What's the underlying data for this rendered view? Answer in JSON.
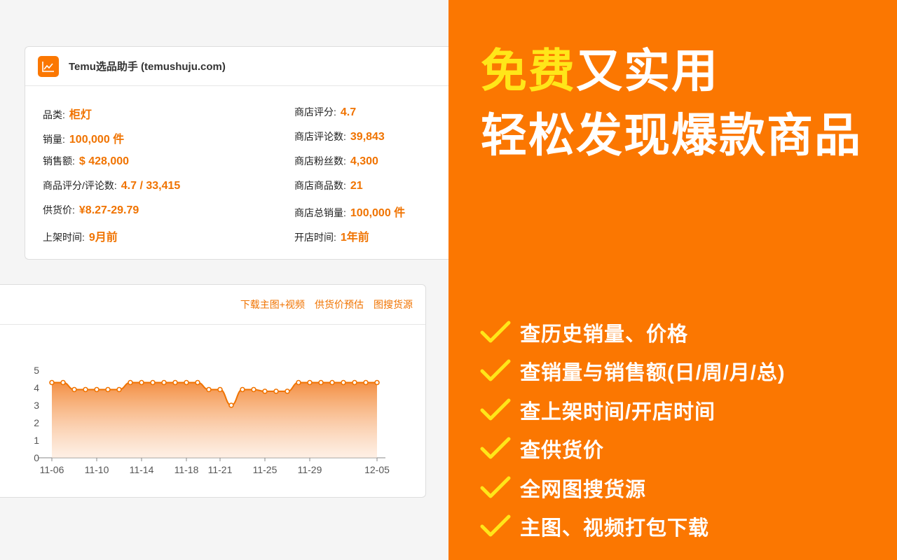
{
  "info_card": {
    "title": "Temu选品助手 (temushuju.com)",
    "logo_icon": "trend-chart-icon",
    "left_items": [
      {
        "label": "品类:",
        "value": "柜灯"
      },
      {
        "label": "销量:",
        "value": "100,000 件"
      },
      {
        "label": "销售额:",
        "value": "$ 428,000"
      },
      {
        "label": "商品评分/评论数:",
        "value": "4.7 / 33,415"
      },
      {
        "label": "供货价:",
        "value": "¥8.27-29.79"
      },
      {
        "label": "上架时间:",
        "value": "9月前"
      }
    ],
    "right_items": [
      {
        "label": "商店评分:",
        "value": "4.7"
      },
      {
        "label": "商店评论数:",
        "value": "39,843"
      },
      {
        "label": "商店粉丝数:",
        "value": "4,300"
      },
      {
        "label": "商店商品数:",
        "value": "21"
      },
      {
        "label": "商店总销量:",
        "value": "100,000 件"
      },
      {
        "label": "开店时间:",
        "value": "1年前"
      }
    ]
  },
  "chart_card": {
    "links": [
      "下载主图+视频",
      "供货价预估",
      "图搜货源"
    ]
  },
  "chart_data": {
    "type": "area",
    "x": [
      "11-06",
      "11-07",
      "11-08",
      "11-09",
      "11-10",
      "11-11",
      "11-12",
      "11-13",
      "11-14",
      "11-15",
      "11-16",
      "11-17",
      "11-18",
      "11-19",
      "11-20",
      "11-21",
      "11-22",
      "11-23",
      "11-24",
      "11-25",
      "11-26",
      "11-27",
      "11-28",
      "11-29",
      "11-30",
      "12-01",
      "12-02",
      "12-03",
      "12-04",
      "12-05"
    ],
    "series": [
      {
        "values": [
          4.3,
          4.3,
          3.9,
          3.9,
          3.9,
          3.9,
          3.9,
          4.3,
          4.3,
          4.3,
          4.3,
          4.3,
          4.3,
          4.3,
          3.9,
          3.9,
          3.0,
          3.9,
          3.9,
          3.8,
          3.8,
          3.8,
          4.3,
          4.3,
          4.3,
          4.3,
          4.3,
          4.3,
          4.3,
          4.3
        ]
      }
    ],
    "xticks": [
      "11-06",
      "11-10",
      "11-14",
      "11-18",
      "11-21",
      "11-25",
      "11-29",
      "12-05"
    ],
    "yticks": [
      "0",
      "1",
      "2",
      "3",
      "4",
      "5"
    ],
    "ylim": [
      0,
      5
    ],
    "color": "#f07300"
  },
  "promo": {
    "line1_highlight": "免费",
    "line1_rest": "又实用",
    "line2": "轻松发现爆款商品",
    "highlight_color": "#ffe619",
    "background_color": "#fb7701",
    "check_icon": "check-icon",
    "features": [
      "查历史销量、价格",
      "查销量与销售额(日/周/月/总)",
      "查上架时间/开店时间",
      "查供货价",
      "全网图搜货源",
      "主图、视频打包下载"
    ]
  }
}
